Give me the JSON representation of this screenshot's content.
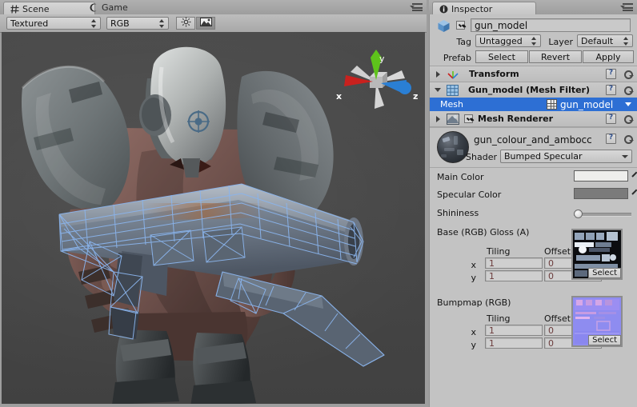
{
  "scene_panel": {
    "tabs": [
      {
        "label": "Scene",
        "icon": "grid-icon",
        "active": true
      },
      {
        "label": "Game",
        "icon": "gamepad-icon",
        "active": false
      }
    ],
    "toolbar": {
      "draw_mode": "Textured",
      "render_mode": "RGB",
      "light_toggle_icon": "sun-icon",
      "audio_toggle_icon": "image-icon"
    },
    "gizmo": {
      "x_label": "x",
      "y_label": "y",
      "z_label": "z",
      "x_color": "#c9211e",
      "y_color": "#5ec31b",
      "z_color": "#2a7fd4"
    },
    "menu_icon": "panel-menu-icon"
  },
  "inspector": {
    "tab_label": "Inspector",
    "tab_icon": "info-icon",
    "menu_icon": "panel-menu-icon",
    "object": {
      "icon": "cube-icon",
      "enabled": true,
      "name": "gun_model",
      "tag_label": "Tag",
      "tag_value": "Untagged",
      "layer_label": "Layer",
      "layer_value": "Default",
      "prefab_label": "Prefab",
      "prefab_buttons": [
        "Select",
        "Revert",
        "Apply"
      ]
    },
    "components": [
      {
        "name": "Transform",
        "icon": "transform-icon",
        "expanded": false,
        "has_checkbox": false,
        "help_icon": "help-icon",
        "gear_icon": "gear-icon"
      },
      {
        "name": "Gun_model (Mesh Filter)",
        "icon": "mesh-filter-icon",
        "expanded": true,
        "has_checkbox": false,
        "help_icon": "help-icon",
        "gear_icon": "gear-icon",
        "field_label": "Mesh",
        "field_value": "gun_model",
        "field_icon": "mesh-icon",
        "field_selected": true
      },
      {
        "name": "Mesh Renderer",
        "icon": "mesh-renderer-icon",
        "expanded": false,
        "has_checkbox": true,
        "checked": true,
        "help_icon": "help-icon",
        "gear_icon": "gear-icon"
      }
    ],
    "material": {
      "name": "gun_colour_and_ambocc",
      "preview_icon": "material-sphere-preview",
      "help_icon": "help-icon",
      "gear_icon": "gear-icon",
      "shader_label": "Shader",
      "shader_value": "Bumped Specular",
      "properties": [
        {
          "label": "Main Color",
          "type": "color",
          "color": "#eeeeec",
          "picker_icon": "eyedropper-icon"
        },
        {
          "label": "Specular Color",
          "type": "color",
          "color": "#7b7b7b",
          "picker_icon": "eyedropper-icon"
        },
        {
          "label": "Shininess",
          "type": "slider",
          "value": 0.04
        }
      ],
      "textures": [
        {
          "label": "Base (RGB) Gloss (A)",
          "tiling_label": "Tiling",
          "offset_label": "Offset",
          "x_label": "x",
          "y_label": "y",
          "tiling_x": "1",
          "tiling_y": "1",
          "offset_x": "0",
          "offset_y": "0",
          "select_label": "Select",
          "preview_icon": "base-texture-preview"
        },
        {
          "label": "Bumpmap (RGB)",
          "tiling_label": "Tiling",
          "offset_label": "Offset",
          "x_label": "x",
          "y_label": "y",
          "tiling_x": "1",
          "tiling_y": "1",
          "offset_x": "0",
          "offset_y": "0",
          "select_label": "Select",
          "preview_icon": "normalmap-texture-preview"
        }
      ]
    }
  },
  "colors": {
    "selection_blue": "#2d6fd4",
    "panel_gray": "#c3c3c3",
    "scene_bg": "#464646",
    "wireframe_blue": "#88b4e8"
  }
}
